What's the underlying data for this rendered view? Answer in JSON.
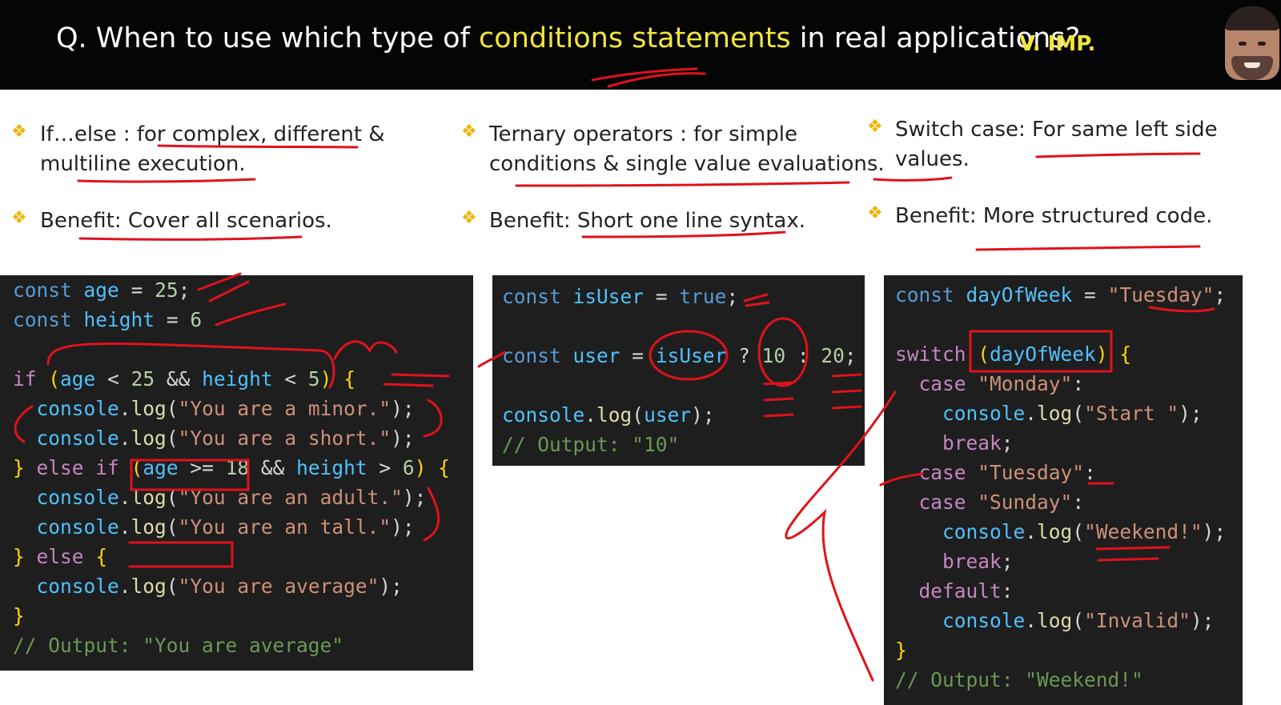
{
  "header": {
    "title_prefix": "Q. When to use which type of ",
    "title_highlight": "conditions statements",
    "title_suffix": " in real applications?",
    "tag": "V. IMP."
  },
  "columns": [
    {
      "heading_line1": "If…else : for complex, different &",
      "heading_line2": "multiline execution.",
      "benefit": "Benefit: Cover all scenarios."
    },
    {
      "heading_line1": "Ternary operators : for simple",
      "heading_line2": "conditions & single value evaluations.",
      "benefit": "Benefit: Short one line syntax."
    },
    {
      "heading_line1": "Switch case: For same left side",
      "heading_line2": "values.",
      "benefit": "Benefit: More structured code."
    }
  ],
  "code": {
    "ifelse": {
      "lines": [
        "const age = 25;",
        "const height = 6",
        "",
        "if (age < 25 && height < 5) {",
        "  console.log(\"You are a minor.\");",
        "  console.log(\"You are a short.\");",
        "} else if (age >= 18 && height > 6) {",
        "  console.log(\"You are an adult.\");",
        "  console.log(\"You are an tall.\");",
        "} else {",
        "  console.log(\"You are average\");",
        "}",
        "// Output: \"You are average\""
      ]
    },
    "ternary": {
      "lines": [
        "const isUser = true;",
        "",
        "const user = isUser ? 10 : 20;",
        "",
        "console.log(user);",
        "// Output: \"10\""
      ]
    },
    "switch": {
      "lines": [
        "const dayOfWeek = \"Tuesday\";",
        "",
        "switch (dayOfWeek) {",
        "  case \"Monday\":",
        "    console.log(\"Start \");",
        "    break;",
        "  case \"Tuesday\":",
        "  case \"Sunday\":",
        "    console.log(\"Weekend!\");",
        "    break;",
        "  default:",
        "    console.log(\"Invalid\");",
        "}",
        "// Output: \"Weekend!\""
      ]
    }
  },
  "colors": {
    "header_bg": "#050505",
    "highlight": "#f2e63c",
    "bullet_diamond": "#f0b400",
    "code_bg": "#1e1e1e",
    "annotation_ink": "#e0121c"
  },
  "icons": [
    "presenter-avatar",
    "diamond-bullet-icon"
  ]
}
